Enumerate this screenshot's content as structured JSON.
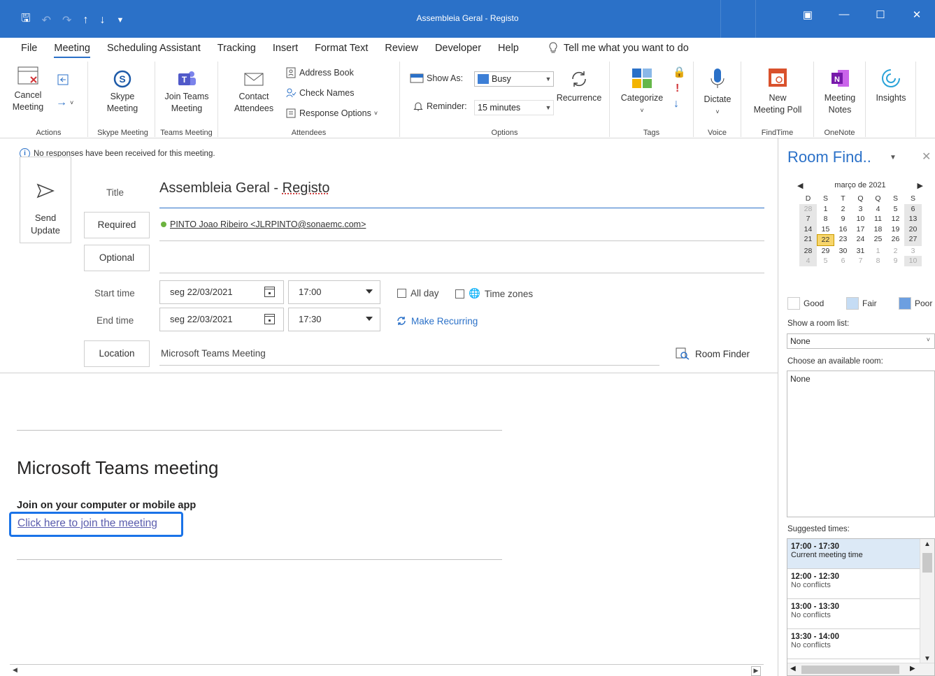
{
  "window": {
    "title": "Assembleia Geral - Registo",
    "qat_icons": [
      "save-icon",
      "undo-icon",
      "redo-icon",
      "up-arrow-icon",
      "down-arrow-icon",
      "customize-icon"
    ],
    "controls": [
      "restore-icon",
      "minimize-icon",
      "maximize-icon",
      "close-icon"
    ]
  },
  "menu": {
    "tabs": [
      "File",
      "Meeting",
      "Scheduling Assistant",
      "Tracking",
      "Insert",
      "Format Text",
      "Review",
      "Developer",
      "Help"
    ],
    "active": "Meeting",
    "tell_me": "Tell me what you want to do"
  },
  "ribbon": {
    "actions": {
      "label": "Actions",
      "cancel": "Cancel\nMeeting"
    },
    "skype": {
      "label": "Skype Meeting",
      "button": "Skype\nMeeting"
    },
    "teams": {
      "label": "Teams Meeting",
      "button": "Join Teams\nMeeting"
    },
    "attendees": {
      "label": "Attendees",
      "contact": "Contact\nAttendees",
      "address_book": "Address Book",
      "check_names": "Check Names",
      "response_options": "Response Options"
    },
    "options": {
      "label": "Options",
      "show_as": "Show As:",
      "show_as_value": "Busy",
      "reminder": "Reminder:",
      "reminder_value": "15 minutes",
      "recurrence": "Recurrence"
    },
    "tags": {
      "label": "Tags",
      "categorize": "Categorize"
    },
    "voice": {
      "label": "Voice",
      "dictate": "Dictate"
    },
    "findtime": {
      "label": "FindTime",
      "poll": "New\nMeeting Poll"
    },
    "onenote": {
      "label": "OneNote",
      "notes": "Meeting\nNotes"
    },
    "insights": {
      "button": "Insights"
    }
  },
  "info_bar": "No responses have been received for this meeting.",
  "form": {
    "send": "Send\nUpdate",
    "title_label": "Title",
    "title_value_a": "Assembleia Geral - ",
    "title_value_b": "Registo",
    "required_label": "Required",
    "required_value": "PINTO Joao Ribeiro <JLRPINTO@sonaemc.com>",
    "optional_label": "Optional",
    "start_label": "Start time",
    "start_date": "seg 22/03/2021",
    "start_time": "17:00",
    "all_day": "All day",
    "time_zones": "Time zones",
    "end_label": "End time",
    "end_date": "seg 22/03/2021",
    "end_time": "17:30",
    "make_recurring": "Make Recurring",
    "location_label": "Location",
    "location_value": "Microsoft Teams Meeting",
    "room_finder": "Room Finder"
  },
  "body": {
    "heading": "Microsoft Teams meeting",
    "join_heading": "Join on your computer or mobile app",
    "join_link": "Click here to join the meeting"
  },
  "room_finder": {
    "title": "Room Find..",
    "month": "março de 2021",
    "weekdays": [
      "D",
      "S",
      "T",
      "Q",
      "Q",
      "S",
      "S"
    ],
    "weeks": [
      [
        "28",
        "1",
        "2",
        "3",
        "4",
        "5",
        "6"
      ],
      [
        "7",
        "8",
        "9",
        "10",
        "11",
        "12",
        "13"
      ],
      [
        "14",
        "15",
        "16",
        "17",
        "18",
        "19",
        "20"
      ],
      [
        "21",
        "22",
        "23",
        "24",
        "25",
        "26",
        "27"
      ],
      [
        "28",
        "29",
        "30",
        "31",
        "1",
        "2",
        "3"
      ],
      [
        "4",
        "5",
        "6",
        "7",
        "8",
        "9",
        "10"
      ]
    ],
    "selected_day": "22",
    "legend": [
      "Good",
      "Fair",
      "Poor"
    ],
    "legend_colors": [
      "#ffffff",
      "#c5dcf4",
      "#6d9fe0"
    ],
    "room_list_label": "Show a room list:",
    "room_list_value": "None",
    "available_label": "Choose an available room:",
    "available_value": "None",
    "suggested_label": "Suggested times:",
    "suggestions": [
      {
        "time": "17:00 - 17:30",
        "status": "Current meeting time"
      },
      {
        "time": "12:00 - 12:30",
        "status": "No conflicts"
      },
      {
        "time": "13:00 - 13:30",
        "status": "No conflicts"
      },
      {
        "time": "13:30 - 14:00",
        "status": "No conflicts"
      }
    ]
  },
  "colors": {
    "accent": "#2b71c8",
    "link": "#5a5cad",
    "highlight_border": "#1a73e8"
  }
}
